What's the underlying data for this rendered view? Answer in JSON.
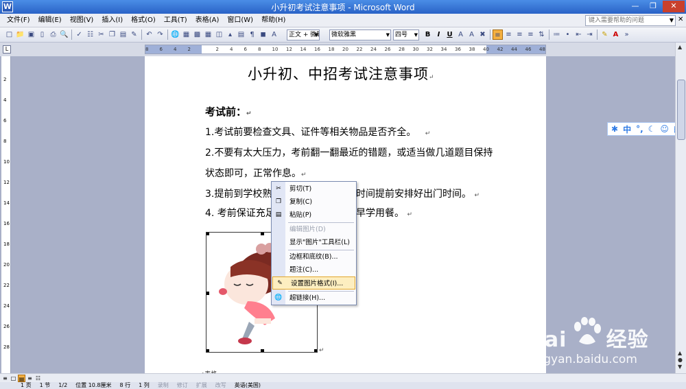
{
  "window": {
    "title": "小升初考试注意事项 - Microsoft Word"
  },
  "menu": {
    "items": [
      "文件(F)",
      "编辑(E)",
      "视图(V)",
      "插入(I)",
      "格式(O)",
      "工具(T)",
      "表格(A)",
      "窗口(W)",
      "帮助(H)"
    ],
    "help_placeholder": "键入需要帮助的问题"
  },
  "toolbar": {
    "style_value": "正文 + 微软",
    "font_value": "微软雅黑",
    "size_value": "四号"
  },
  "ruler": {
    "numbers": [
      "8",
      "6",
      "4",
      "2",
      "",
      "2",
      "4",
      "6",
      "8",
      "10",
      "12",
      "14",
      "16",
      "18",
      "20",
      "22",
      "24",
      "26",
      "28",
      "30",
      "32",
      "34",
      "36",
      "38",
      "40",
      "42",
      "44",
      "46",
      "48"
    ]
  },
  "document": {
    "title": "小升初、中招考试注意事项",
    "heading": "考试前：",
    "lines": [
      "1.考试前要检查文具、证件等相关物品是否齐全。",
      "2.不要有太大压力，考前翻一翻最近的错题，或适当做几道题目保持",
      "状态即可，正常作息。",
      "3.提前到学校熟",
      "4.  考前保证充足"
    ],
    "line3_tail": "时间提前安排好出门时间。",
    "line4_tail": "早学用餐。",
    "bottom_text": "•表格"
  },
  "context_menu": {
    "items": [
      {
        "label": "剪切(T)",
        "icon": "scissors-icon",
        "disabled": false
      },
      {
        "label": "复制(C)",
        "icon": "copy-icon",
        "disabled": false
      },
      {
        "label": "粘贴(P)",
        "icon": "paste-icon",
        "disabled": false
      },
      {
        "label": "编辑图片(D)",
        "icon": "",
        "disabled": true
      },
      {
        "label": "显示\"图片\"工具栏(L)",
        "icon": "",
        "disabled": false
      },
      {
        "label": "边框和底纹(B)...",
        "icon": "",
        "disabled": false
      },
      {
        "label": "题注(C)...",
        "icon": "",
        "disabled": false
      },
      {
        "label": "设置图片格式(I)...",
        "icon": "format-picture-icon",
        "disabled": false,
        "highlighted": true
      },
      {
        "label": "超链接(H)...",
        "icon": "hyperlink-icon",
        "disabled": false
      }
    ]
  },
  "status_bar": {
    "page": "1 页",
    "section": "1 节",
    "page_of": "1/2",
    "position": "位置 10.8厘米",
    "line": "8 行",
    "col": "1 列",
    "modes": [
      "录制",
      "修订",
      "扩展",
      "改写"
    ],
    "language": "英语(美国)"
  },
  "watermark": {
    "logo": "Bai",
    "logo_cn": "经验",
    "url": "jingyan.baidu.com"
  },
  "colors": {
    "title_bar": "#2a63c7",
    "page_bg": "#a9b0c8",
    "highlight": "#fdeec0"
  }
}
